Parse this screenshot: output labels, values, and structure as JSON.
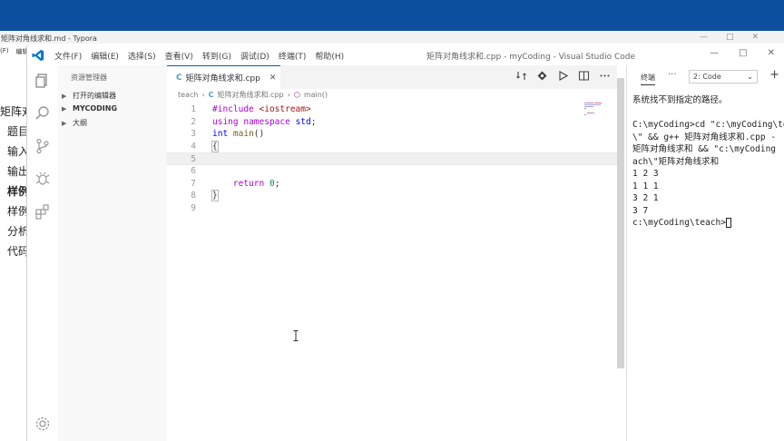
{
  "typora": {
    "title": "矩阵对角线求和.md - Typora",
    "controls": [
      "—",
      "□",
      "✕"
    ],
    "menu": [
      "(F)",
      "编辑"
    ],
    "left_items": [
      {
        "text": "矩阵对",
        "bold": false
      },
      {
        "text": "题目",
        "bold": false
      },
      {
        "text": "输入",
        "bold": false
      },
      {
        "text": "输出",
        "bold": false
      },
      {
        "text": "样例",
        "bold": true
      },
      {
        "text": "样例",
        "bold": false
      },
      {
        "text": "分析",
        "bold": false
      },
      {
        "text": "代码",
        "bold": false
      }
    ]
  },
  "vscode": {
    "title": "矩阵对角线求和.cpp - myCoding - Visual Studio Code",
    "menu": [
      "文件(F)",
      "编辑(E)",
      "选择(S)",
      "查看(V)",
      "转到(G)",
      "调试(D)",
      "终端(T)",
      "帮助(H)"
    ],
    "win_controls": [
      "—",
      "□",
      "✕"
    ],
    "sidebar": {
      "title": "资源管理器",
      "items": [
        {
          "label": "打开的编辑器",
          "bold": false
        },
        {
          "label": "MYCODING",
          "bold": true
        },
        {
          "label": "大纲",
          "bold": false
        }
      ]
    },
    "tab": {
      "icon": "C",
      "label": "矩阵对角线求和.cpp",
      "close": "✕"
    },
    "breadcrumbs": [
      "teach",
      "矩阵对角线求和.cpp",
      "main()"
    ],
    "editor_lines": [
      {
        "n": "1"
      },
      {
        "n": "2"
      },
      {
        "n": "3"
      },
      {
        "n": "4"
      },
      {
        "n": "5"
      },
      {
        "n": "6"
      },
      {
        "n": "7"
      },
      {
        "n": "8"
      },
      {
        "n": "9"
      }
    ],
    "code": {
      "l1_kw": "#include",
      "l1_str": "<iostream>",
      "l2_kw": "using",
      "l2_kw2": "namespace",
      "l2_ns": "std",
      "l3_type": "int",
      "l3_fn": "main",
      "l3_paren": "()",
      "l4": "{",
      "l7_kw": "return",
      "l7_num": "0",
      "l8": "}"
    },
    "terminal": {
      "tab_label": "终端",
      "more": "···",
      "shell_select": "2: Code",
      "plus": "+",
      "lines": [
        "系统找不到指定的路径。",
        "",
        "C:\\myCoding>cd \"c:\\myCoding\\te",
        "\\\" && g++ 矩阵对角线求和.cpp -",
        "矩阵对角线求和 && \"c:\\myCoding",
        "ach\\\"矩阵对角线求和",
        "1 2 3",
        "1 1 1",
        "3 2 1",
        "3 7",
        "c:\\myCoding\\teach>"
      ]
    }
  }
}
